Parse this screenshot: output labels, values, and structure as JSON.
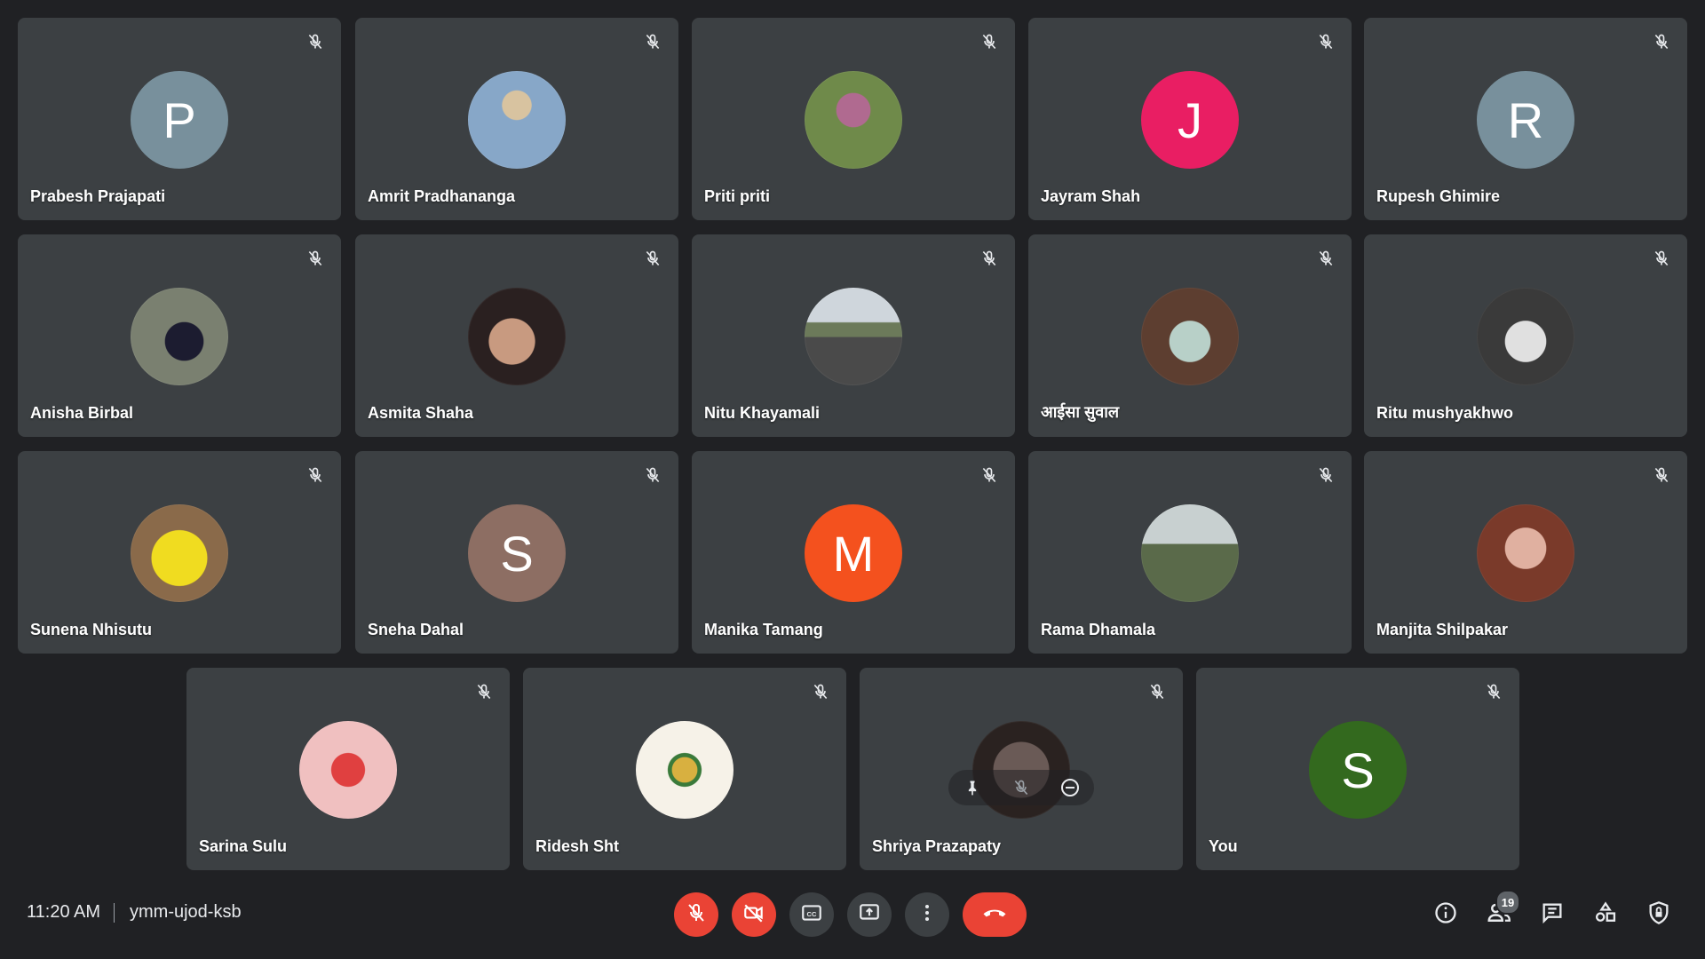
{
  "participants": [
    {
      "name": "Prabesh Prajapati",
      "avatar_type": "initial",
      "initial": "P",
      "color": "#78909c"
    },
    {
      "name": "Amrit Pradhananga",
      "avatar_type": "photo",
      "initial": "",
      "color": "#8a9aa8"
    },
    {
      "name": "Priti priti",
      "avatar_type": "photo",
      "initial": "",
      "color": "#7a8a5a"
    },
    {
      "name": "Jayram Shah",
      "avatar_type": "initial",
      "initial": "J",
      "color": "#e91e63"
    },
    {
      "name": "Rupesh Ghimire",
      "avatar_type": "initial",
      "initial": "R",
      "color": "#78909c"
    },
    {
      "name": "Anisha Birbal",
      "avatar_type": "photo",
      "initial": "",
      "color": "#6d6f6a"
    },
    {
      "name": "Asmita Shaha",
      "avatar_type": "photo",
      "initial": "",
      "color": "#4a3a36"
    },
    {
      "name": "Nitu Khayamali",
      "avatar_type": "photo",
      "initial": "",
      "color": "#8a908a"
    },
    {
      "name": "आईसा सुवाल",
      "avatar_type": "photo",
      "initial": "",
      "color": "#5d4a3c"
    },
    {
      "name": "Ritu mushyakhwo",
      "avatar_type": "photo",
      "initial": "",
      "color": "#8f8f8f"
    },
    {
      "name": "Sunena Nhisutu",
      "avatar_type": "photo",
      "initial": "",
      "color": "#e8d21e"
    },
    {
      "name": "Sneha Dahal",
      "avatar_type": "initial",
      "initial": "S",
      "color": "#8d6e63"
    },
    {
      "name": "Manika Tamang",
      "avatar_type": "initial",
      "initial": "M",
      "color": "#f4511e"
    },
    {
      "name": "Rama Dhamala",
      "avatar_type": "photo",
      "initial": "",
      "color": "#7f8c7a"
    },
    {
      "name": "Manjita Shilpakar",
      "avatar_type": "photo",
      "initial": "",
      "color": "#6a4a3a"
    },
    {
      "name": "Sarina Sulu",
      "avatar_type": "photo",
      "initial": "",
      "color": "#e8b0b0"
    },
    {
      "name": "Ridesh Sht",
      "avatar_type": "photo",
      "initial": "",
      "color": "#f4f0e6"
    },
    {
      "name": "Shriya Prazapaty",
      "avatar_type": "photo",
      "initial": "",
      "color": "#4a3f3c"
    },
    {
      "name": "You",
      "avatar_type": "initial",
      "initial": "S",
      "color": "#33691e"
    }
  ],
  "bottom_bar": {
    "time": "11:20 AM",
    "meeting_code": "ymm-ujod-ksb",
    "people_count": "19"
  },
  "colors": {
    "background": "#202124",
    "tile": "#3c4043",
    "danger": "#ea4335"
  },
  "icons": {
    "tile": [
      "mic-off-icon"
    ],
    "hover_overlay": [
      "pin-icon",
      "mute-icon",
      "remove-icon"
    ],
    "controls": [
      "mic-off-icon",
      "camera-off-icon",
      "captions-icon",
      "present-icon",
      "more-options-icon",
      "end-call-icon"
    ],
    "right": [
      "info-icon",
      "people-icon",
      "chat-icon",
      "activities-icon",
      "host-controls-icon"
    ]
  }
}
